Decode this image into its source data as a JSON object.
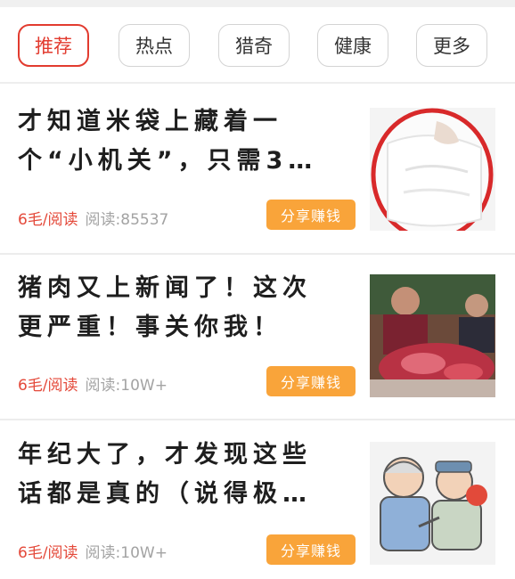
{
  "tabs": [
    {
      "label": "推荐",
      "active": true
    },
    {
      "label": "热点",
      "active": false
    },
    {
      "label": "猎奇",
      "active": false
    },
    {
      "label": "健康",
      "active": false
    },
    {
      "label": "更多",
      "active": false
    }
  ],
  "articles": [
    {
      "title_line1": "才知道米袋上藏着一",
      "title_line2": "个“小机关”，只需3…",
      "price": "6毛/阅读",
      "reads": "阅读:85537",
      "share_label": "分享赚钱",
      "thumbnail": "rice-bag-photo"
    },
    {
      "title_line1": "猪肉又上新闻了！这次",
      "title_line2": "更严重！事关你我！",
      "price": "6毛/阅读",
      "reads": "阅读:10W+",
      "share_label": "分享赚钱",
      "thumbnail": "pork-market-photo"
    },
    {
      "title_line1": "年纪大了，才发现这些",
      "title_line2": "话都是真的（说得极…",
      "price": "6毛/阅读",
      "reads": "阅读:10W+",
      "share_label": "分享赚钱",
      "thumbnail": "elderly-illustration"
    }
  ],
  "colors": {
    "accent": "#e23b2f",
    "share_button": "#f9a43a",
    "muted_text": "#a3a3a3"
  }
}
